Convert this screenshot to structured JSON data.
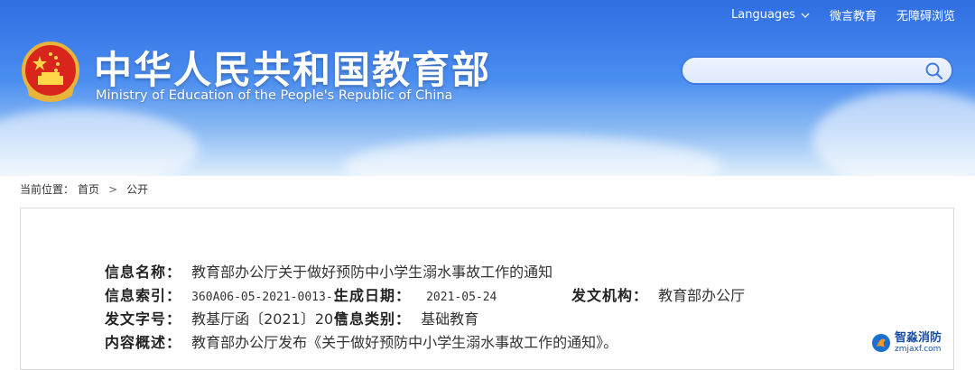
{
  "header": {
    "title_cn": "中华人民共和国教育部",
    "title_en": "Ministry of Education of the People's Republic of China",
    "links": {
      "languages": "Languages",
      "wechat": "微言教育",
      "accessibility": "无障碍浏览"
    },
    "search": {
      "placeholder": "",
      "value": ""
    }
  },
  "breadcrumb": {
    "prefix": "当前位置：",
    "home": "首页",
    "separator": ">",
    "current": "公开"
  },
  "meta": {
    "name_label": "信息名称：",
    "name_value": "教育部办公厅关于做好预防中小学生溺水事故工作的通知",
    "index_label": "信息索引：",
    "index_value": "360A06-05-2021-0013-1",
    "date_label": "生成日期：",
    "date_value": "2021-05-24",
    "org_label": "发文机构：",
    "org_value": "教育部办公厅",
    "doc_label": "发文字号：",
    "doc_value": "教基厅函〔2021〕20号",
    "cat_label": "信息类别：",
    "cat_value": "基础教育",
    "summary_label": "内容概述：",
    "summary_value": "教育部办公厅发布《关于做好预防中小学生溺水事故工作的通知》。"
  },
  "watermark": {
    "cn": "智淼消防",
    "en": "zmjaxf.com"
  },
  "colors": {
    "header_top": "#2f6ee2",
    "header_bottom": "#dfeefc",
    "search_border": "#3f7be0",
    "watermark": "#1b4fa5"
  }
}
